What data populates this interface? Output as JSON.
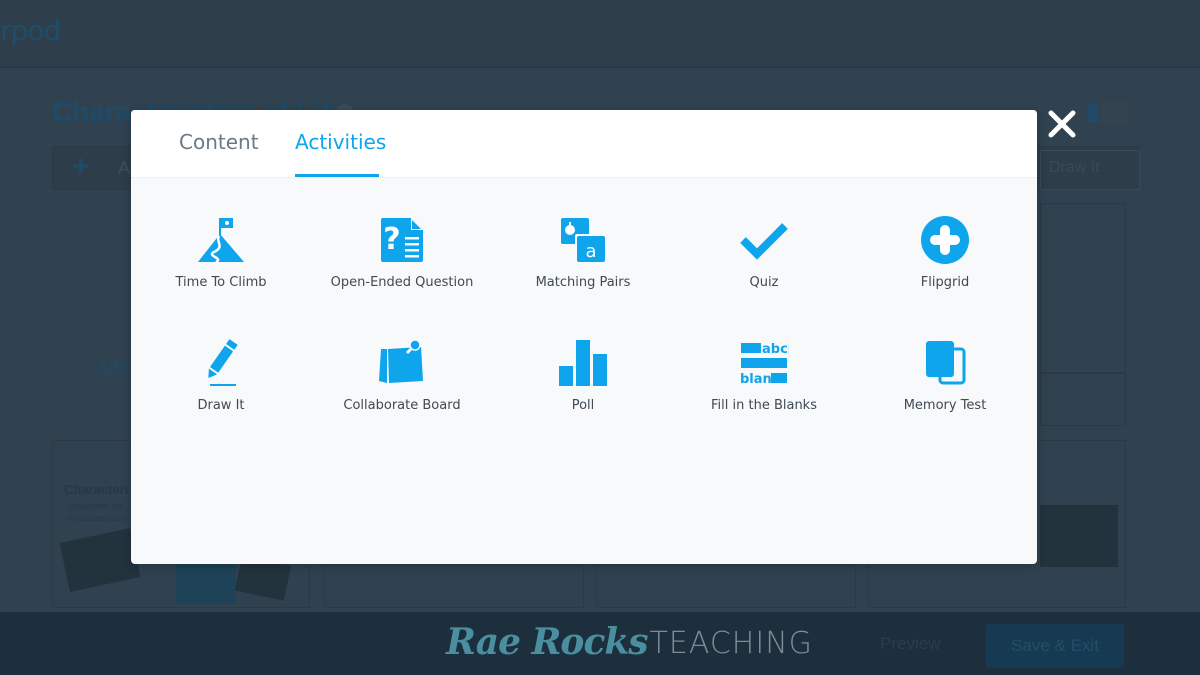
{
  "background": {
    "logo_text": "rpod",
    "lesson_title": "Characteristics of Life",
    "add_label": "A",
    "add_slide_label": "Add",
    "draw_it_button": "Draw It",
    "slide_title": "Characteri",
    "slide_subtitle_1": "Organism: An",
    "slide_subtitle_2": "characteristics",
    "preview_label": "Preview",
    "save_exit_label": "Save & Exit"
  },
  "watermark": {
    "script": "Rae Rocks",
    "caps": "TEACHING"
  },
  "modal": {
    "tabs": [
      {
        "label": "Content",
        "active": false
      },
      {
        "label": "Activities",
        "active": true
      }
    ],
    "accent_color": "#0ea5ed",
    "activities": [
      {
        "label": "Time To Climb",
        "icon": "mountain-flag-icon"
      },
      {
        "label": "Open-Ended Question",
        "icon": "question-document-icon"
      },
      {
        "label": "Matching Pairs",
        "icon": "matching-cards-icon",
        "icon_text": "a"
      },
      {
        "label": "Quiz",
        "icon": "checkmark-icon"
      },
      {
        "label": "Flipgrid",
        "icon": "plus-circle-icon"
      },
      {
        "label": "Draw It",
        "icon": "pencil-icon"
      },
      {
        "label": "Collaborate Board",
        "icon": "pinned-note-icon"
      },
      {
        "label": "Poll",
        "icon": "bar-chart-icon"
      },
      {
        "label": "Fill in the Blanks",
        "icon": "fill-blanks-icon",
        "icon_text_top": "abcl",
        "icon_text_bottom": "blan"
      },
      {
        "label": "Memory Test",
        "icon": "memory-cards-icon"
      }
    ]
  },
  "close_icon": "close-icon"
}
